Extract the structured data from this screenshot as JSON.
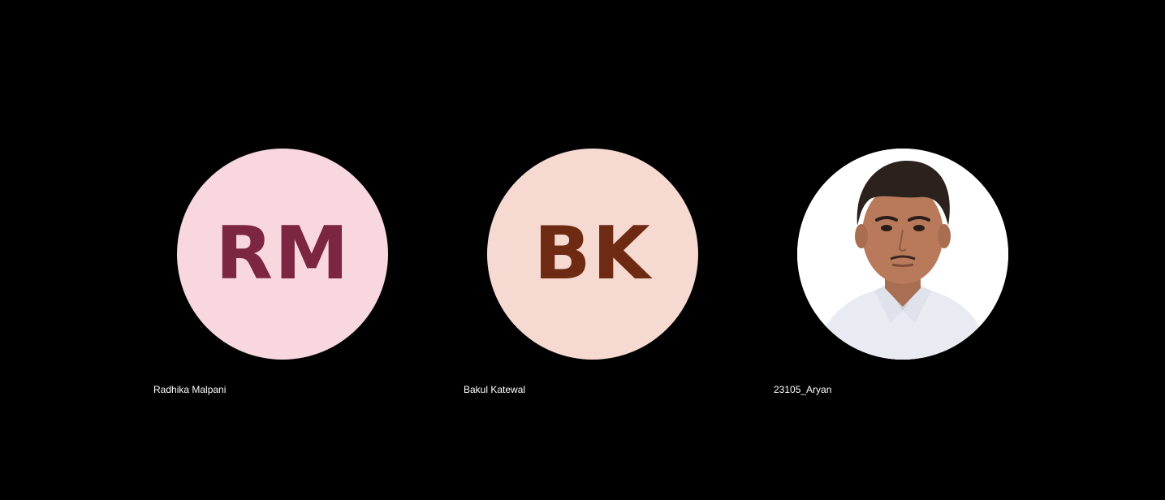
{
  "participants": [
    {
      "name": "Radhika Malpani",
      "initials": "RM",
      "avatar_bg": "#f8d7de",
      "avatar_fg": "#7d2642"
    },
    {
      "name": "Bakul Katewal",
      "initials": "BK",
      "avatar_bg": "#f6dad1",
      "avatar_fg": "#6e2a12"
    },
    {
      "name": "23105_Aryan",
      "avatar_type": "photo"
    }
  ]
}
